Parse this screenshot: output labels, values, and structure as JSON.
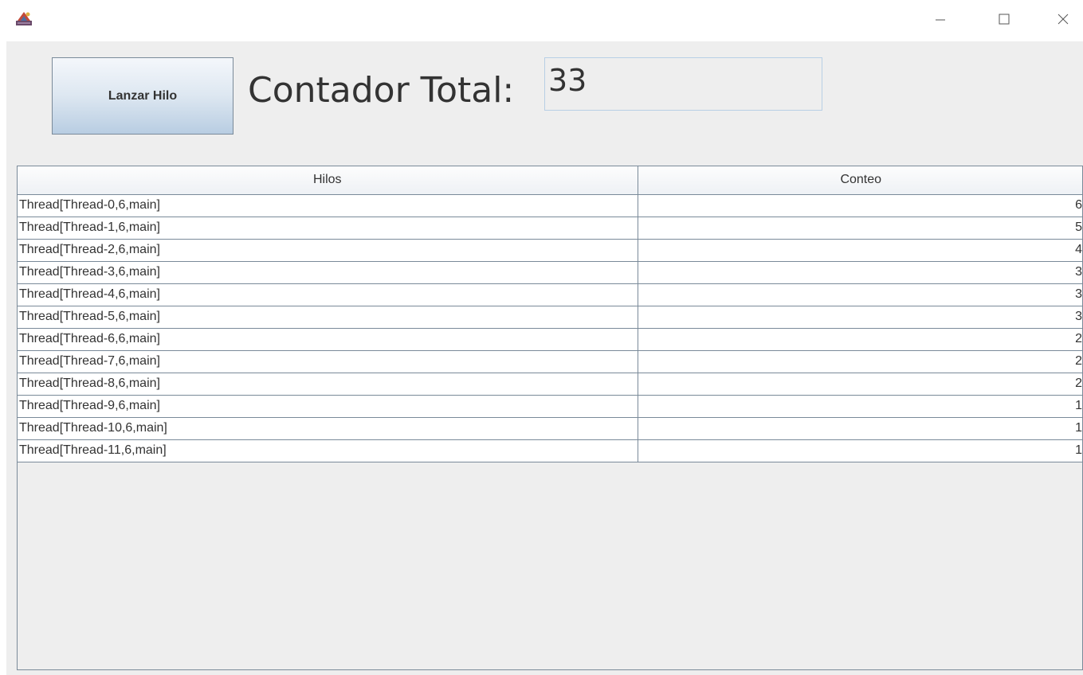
{
  "window": {
    "icon": "java-app-icon",
    "controls": {
      "minimize": "minimize-icon",
      "maximize": "maximize-icon",
      "close": "close-icon"
    }
  },
  "toolbar": {
    "launch_label": "Lanzar Hilo",
    "counter_label": "Contador Total:",
    "counter_value": "33"
  },
  "table": {
    "headers": [
      "Hilos",
      "Conteo"
    ],
    "rows": [
      {
        "thread": "Thread[Thread-0,6,main]",
        "count": "6"
      },
      {
        "thread": "Thread[Thread-1,6,main]",
        "count": "5"
      },
      {
        "thread": "Thread[Thread-2,6,main]",
        "count": "4"
      },
      {
        "thread": "Thread[Thread-3,6,main]",
        "count": "3"
      },
      {
        "thread": "Thread[Thread-4,6,main]",
        "count": "3"
      },
      {
        "thread": "Thread[Thread-5,6,main]",
        "count": "3"
      },
      {
        "thread": "Thread[Thread-6,6,main]",
        "count": "2"
      },
      {
        "thread": "Thread[Thread-7,6,main]",
        "count": "2"
      },
      {
        "thread": "Thread[Thread-8,6,main]",
        "count": "2"
      },
      {
        "thread": "Thread[Thread-9,6,main]",
        "count": "1"
      },
      {
        "thread": "Thread[Thread-10,6,main]",
        "count": "1"
      },
      {
        "thread": "Thread[Thread-11,6,main]",
        "count": "1"
      }
    ]
  },
  "colors": {
    "panel_background": "#eeeeee",
    "button_gradient_top": "#f4f7fb",
    "button_gradient_bottom": "#b8cde2",
    "grid_line": "#7a8a99"
  }
}
